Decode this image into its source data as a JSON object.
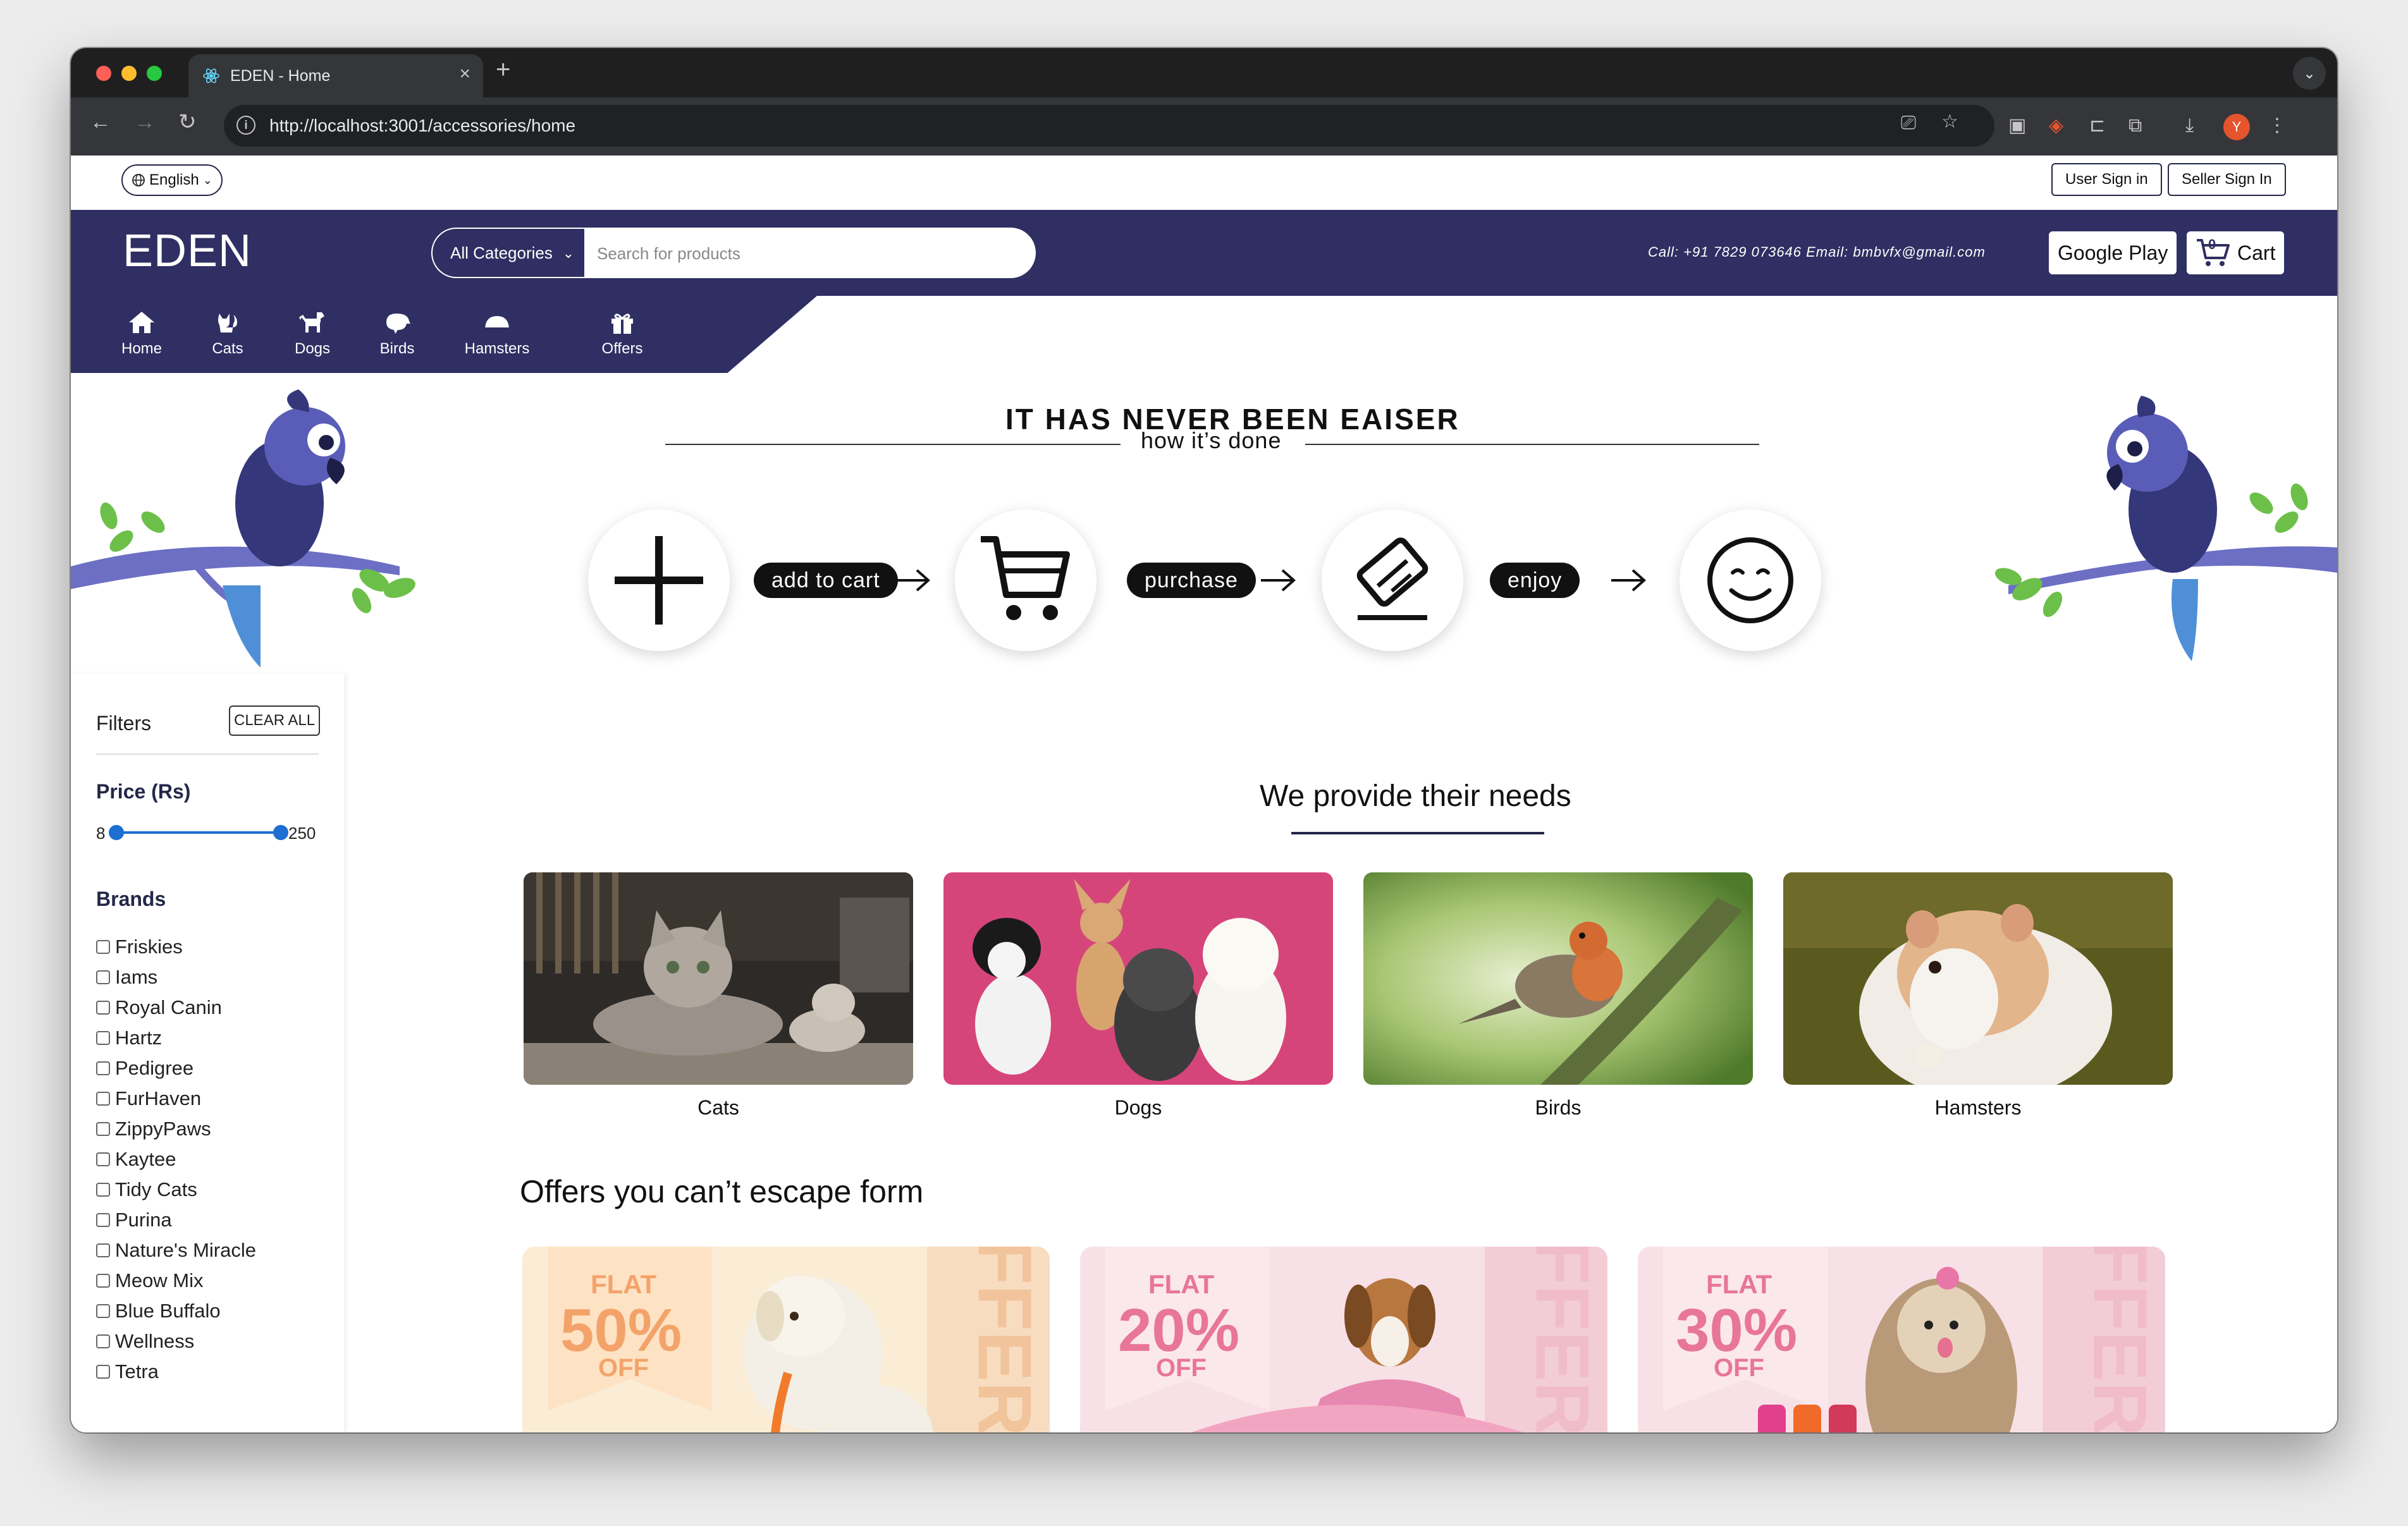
{
  "browser": {
    "tab_title": "EDEN - Home",
    "url": "http://localhost:3001/accessories/home",
    "profile_initial": "Y"
  },
  "topbar": {
    "language": "English",
    "user_signin": "User Sign in",
    "seller_signin": "Seller Sign In"
  },
  "header": {
    "brand": "EDEN",
    "category_select": "All Categories",
    "search_placeholder": "Search for products",
    "contact": "Call: +91 7829 073646  Email: bmbvfx@gmail.com",
    "google_play": "Google Play",
    "cart_label": "Cart",
    "cart_count": "0"
  },
  "category_nav": [
    {
      "label": "Home",
      "icon": "home-icon"
    },
    {
      "label": "Cats",
      "icon": "cat-icon"
    },
    {
      "label": "Dogs",
      "icon": "dog-icon"
    },
    {
      "label": "Birds",
      "icon": "bird-icon"
    },
    {
      "label": "Hamsters",
      "icon": "hamster-icon"
    },
    {
      "label": "Offers",
      "icon": "gift-icon"
    }
  ],
  "hero": {
    "title": "IT HAS NEVER BEEN EAISER",
    "subtitle": "how it’s done",
    "steps": [
      "add to cart",
      "purchase",
      "enjoy"
    ]
  },
  "filters": {
    "title": "Filters",
    "clear_all": "CLEAR ALL",
    "price_heading": "Price (Rs)",
    "price_min": "8",
    "price_max": "250",
    "brands_heading": "Brands",
    "brands": [
      "Friskies",
      "Iams",
      "Royal Canin",
      "Hartz",
      "Pedigree",
      "FurHaven",
      "ZippyPaws",
      "Kaytee",
      "Tidy Cats",
      "Purina",
      "Nature's Miracle",
      "Meow Mix",
      "Blue Buffalo",
      "Wellness",
      "Tetra"
    ]
  },
  "needs": {
    "title": "We provide their needs",
    "cards": [
      "Cats",
      "Dogs",
      "Birds",
      "Hamsters"
    ]
  },
  "offers": {
    "title": "Offers you can’t escape form",
    "cards": [
      {
        "flat": "FLAT",
        "percent": "50%",
        "off": "OFF",
        "vertical": "OFFER"
      },
      {
        "flat": "FLAT",
        "percent": "20%",
        "off": "OFF",
        "vertical": "OFFER"
      },
      {
        "flat": "FLAT",
        "percent": "30%",
        "off": "OFF",
        "vertical": "OFFER"
      }
    ]
  },
  "colors": {
    "navy": "#2f2f63",
    "slider_blue": "#1d6fd1",
    "offer_orange": "#f3a36a",
    "offer_pink": "#e8759a"
  }
}
